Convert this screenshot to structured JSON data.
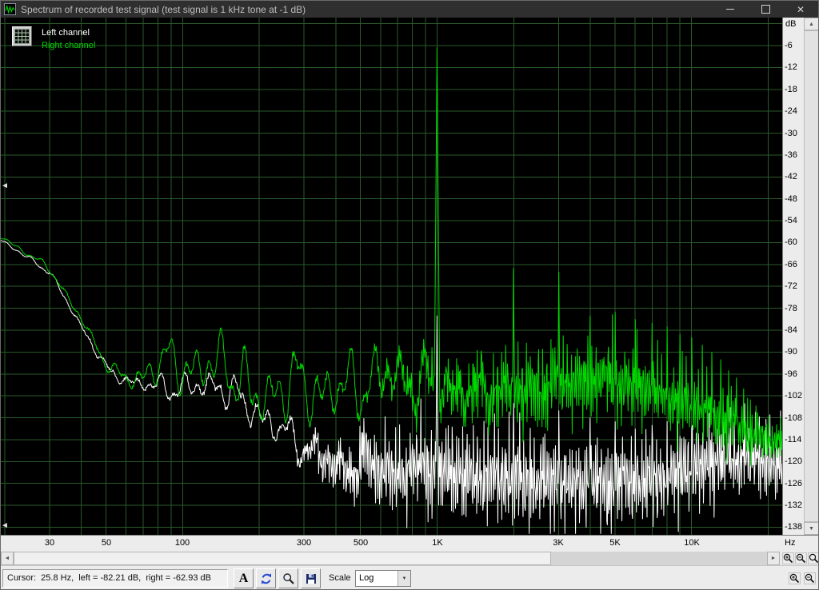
{
  "window": {
    "title": "Spectrum of recorded test signal (test signal is 1 kHz tone at -1 dB)"
  },
  "icons": {
    "minimize": "—",
    "close": "✕",
    "scroll_up": "▲",
    "scroll_down": "▼",
    "scroll_left": "◄",
    "scroll_right": "►",
    "combo_arrow": "▼",
    "left_marker": "◄"
  },
  "legend": {
    "left_label": "Left channel",
    "right_label": "Right channel"
  },
  "axes": {
    "y_unit": "dB",
    "x_unit": "Hz"
  },
  "toolbar": {
    "cursor_text": "Cursor:  25.8 Hz,  left = -82.21 dB,  right = -62.93 dB",
    "font_button_label": "A",
    "scale_label": "Scale",
    "scale_value": "Log"
  },
  "chart_data": {
    "type": "line",
    "title": "Spectrum of recorded test signal (test signal is 1 kHz tone at -1 dB)",
    "x_scale": "log",
    "x_range_hz": [
      19.3,
      22700
    ],
    "y_range_db": [
      0,
      -140
    ],
    "y_tick_step_db": 6,
    "grid": true,
    "legend_position": "top-left",
    "colors": {
      "background": "#000000",
      "grid": "#2a5a2a",
      "left_channel": "#ffffff",
      "right_channel": "#00d800"
    },
    "x_ticks": [
      {
        "f": 30,
        "label": "30"
      },
      {
        "f": 50,
        "label": "50"
      },
      {
        "f": 100,
        "label": "100"
      },
      {
        "f": 300,
        "label": "300"
      },
      {
        "f": 500,
        "label": "500"
      },
      {
        "f": 1000,
        "label": "1K"
      },
      {
        "f": 3000,
        "label": "3K"
      },
      {
        "f": 5000,
        "label": "5K"
      },
      {
        "f": 10000,
        "label": "10K"
      }
    ],
    "y_ticks_db": [
      -6,
      -12,
      -18,
      -24,
      -30,
      -36,
      -42,
      -48,
      -54,
      -60,
      -66,
      -72,
      -78,
      -84,
      -90,
      -96,
      -102,
      -108,
      -114,
      -120,
      -126,
      -132,
      -138
    ],
    "series": [
      {
        "name": "Left channel",
        "color": "#ffffff",
        "envelope": [
          [
            19,
            -59
          ],
          [
            30,
            -68
          ],
          [
            40,
            -83
          ],
          [
            52,
            -96
          ],
          [
            70,
            -99
          ],
          [
            100,
            -100
          ],
          [
            140,
            -99
          ],
          [
            190,
            -106
          ],
          [
            250,
            -112
          ],
          [
            320,
            -117
          ],
          [
            420,
            -122
          ],
          [
            520,
            -120
          ],
          [
            700,
            -123
          ],
          [
            900,
            -121
          ],
          [
            1200,
            -124
          ],
          [
            2000,
            -124
          ],
          [
            3000,
            -126
          ],
          [
            4500,
            -127
          ],
          [
            6000,
            -126
          ],
          [
            8000,
            -124
          ],
          [
            10000,
            -122
          ],
          [
            13000,
            -120
          ],
          [
            16000,
            -119
          ],
          [
            20000,
            -120
          ],
          [
            23000,
            -121
          ]
        ],
        "wiggle": [
          {
            "k": 62,
            "phase": 2.6,
            "amp": [
              [
                19,
                0.5
              ],
              [
                40,
                1
              ],
              [
                70,
                2
              ],
              [
                100,
                4
              ],
              [
                200,
                5
              ],
              [
                350,
                5
              ],
              [
                600,
                3
              ],
              [
                1200,
                2
              ],
              [
                23000,
                1
              ]
            ]
          },
          {
            "k": 760,
            "phase": 0.9,
            "amp": [
              [
                19,
                0
              ],
              [
                250,
                0
              ],
              [
                400,
                6
              ],
              [
                700,
                10
              ],
              [
                1200,
                12
              ],
              [
                3000,
                12
              ],
              [
                8000,
                11
              ],
              [
                15000,
                9
              ],
              [
                23000,
                8
              ]
            ]
          }
        ],
        "hash_amp": [
          [
            19,
            0
          ],
          [
            300,
            1
          ],
          [
            600,
            3
          ],
          [
            23000,
            4
          ]
        ],
        "peaks": [
          [
            1000,
            -80
          ],
          [
            2000,
            -104
          ],
          [
            3000,
            -106
          ],
          [
            4000,
            -108
          ],
          [
            5000,
            -109
          ],
          [
            6000,
            -111
          ],
          [
            7000,
            -110
          ],
          [
            8000,
            -112
          ],
          [
            9000,
            -113
          ],
          [
            10000,
            -111
          ],
          [
            12000,
            -112
          ],
          [
            14000,
            -113
          ],
          [
            16000,
            -114
          ]
        ]
      },
      {
        "name": "Right channel",
        "color": "#00d800",
        "envelope": [
          [
            19,
            -58
          ],
          [
            30,
            -67
          ],
          [
            40,
            -81
          ],
          [
            52,
            -95
          ],
          [
            65,
            -98
          ],
          [
            85,
            -92
          ],
          [
            110,
            -95
          ],
          [
            150,
            -93
          ],
          [
            200,
            -104
          ],
          [
            260,
            -98
          ],
          [
            350,
            -101
          ],
          [
            500,
            -99
          ],
          [
            650,
            -96
          ],
          [
            800,
            -98
          ],
          [
            1000,
            -99
          ],
          [
            1300,
            -101
          ],
          [
            1700,
            -100
          ],
          [
            2200,
            -101
          ],
          [
            3000,
            -99
          ],
          [
            4000,
            -97
          ],
          [
            5000,
            -98
          ],
          [
            6500,
            -100
          ],
          [
            8000,
            -102
          ],
          [
            10000,
            -105
          ],
          [
            13000,
            -108
          ],
          [
            17000,
            -112
          ],
          [
            23000,
            -115
          ]
        ],
        "wiggle": [
          {
            "k": 62,
            "phase": 0.4,
            "amp": [
              [
                19,
                0.5
              ],
              [
                50,
                1.5
              ],
              [
                80,
                5
              ],
              [
                110,
                8
              ],
              [
                200,
                9
              ],
              [
                400,
                9
              ],
              [
                800,
                8
              ],
              [
                1500,
                4
              ],
              [
                3000,
                2
              ],
              [
                23000,
                1.5
              ]
            ]
          },
          {
            "k": 780,
            "phase": 2.0,
            "amp": [
              [
                19,
                0
              ],
              [
                500,
                1
              ],
              [
                900,
                5
              ],
              [
                1500,
                8
              ],
              [
                2500,
                10
              ],
              [
                5000,
                10
              ],
              [
                9000,
                9
              ],
              [
                15000,
                7
              ],
              [
                23000,
                5
              ]
            ]
          }
        ],
        "hash_amp": [
          [
            19,
            0
          ],
          [
            700,
            0.5
          ],
          [
            1200,
            2.5
          ],
          [
            23000,
            3
          ]
        ],
        "peaks": [
          [
            1000,
            -6.5
          ],
          [
            1500,
            -91
          ],
          [
            2000,
            -67
          ],
          [
            2500,
            -93
          ],
          [
            3000,
            -68
          ],
          [
            3500,
            -92
          ],
          [
            4000,
            -80
          ],
          [
            4500,
            -93
          ],
          [
            5000,
            -79
          ],
          [
            5500,
            -94
          ],
          [
            6000,
            -81
          ],
          [
            7000,
            -82
          ],
          [
            8000,
            -83
          ],
          [
            9000,
            -85
          ],
          [
            10000,
            -86
          ],
          [
            11000,
            -88
          ],
          [
            12000,
            -90
          ],
          [
            13000,
            -92
          ],
          [
            14000,
            -95
          ],
          [
            15000,
            -97
          ],
          [
            16000,
            -100
          ],
          [
            17000,
            -103
          ]
        ]
      }
    ]
  }
}
